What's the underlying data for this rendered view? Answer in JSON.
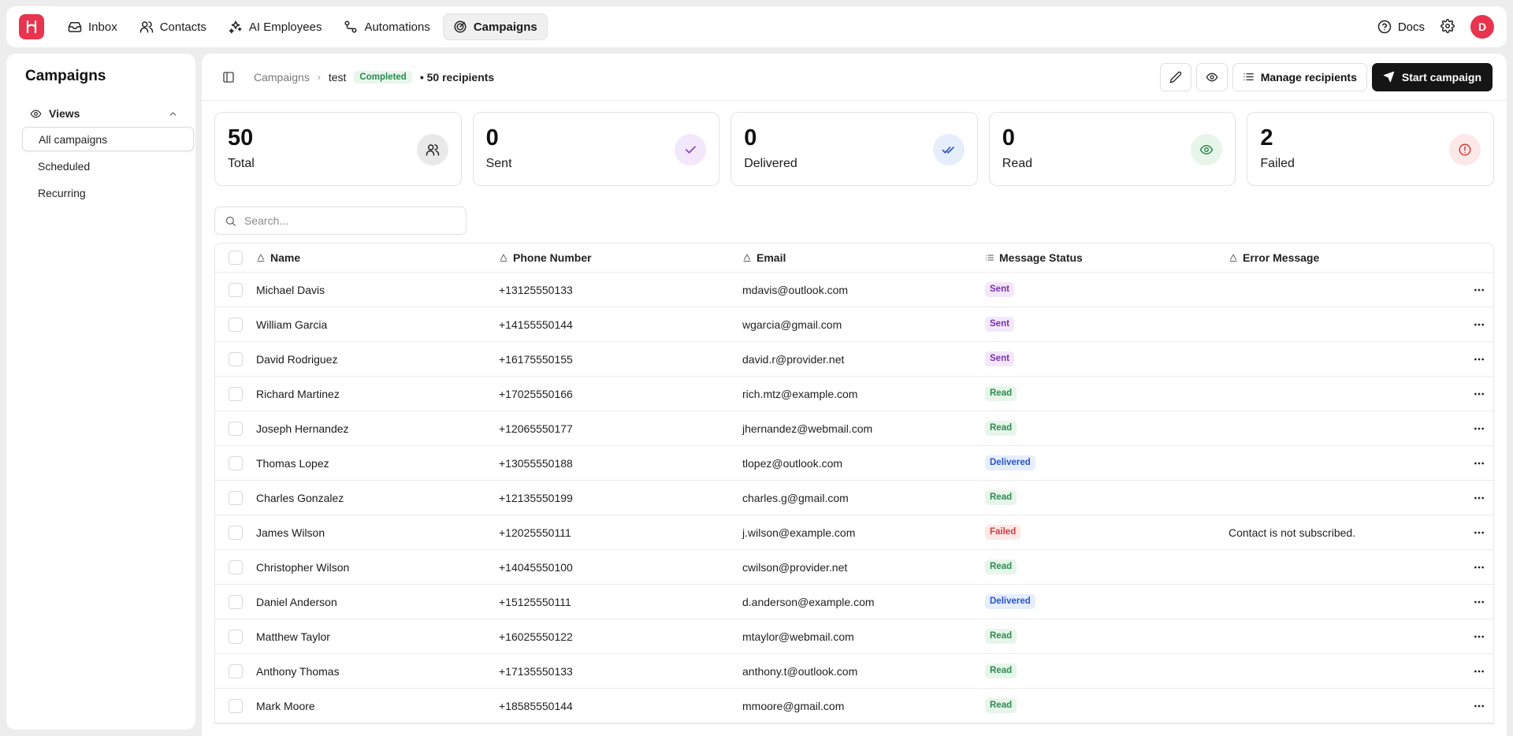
{
  "nav": {
    "items": [
      {
        "label": "Inbox",
        "icon": "inbox-icon"
      },
      {
        "label": "Contacts",
        "icon": "users-icon"
      },
      {
        "label": "AI Employees",
        "icon": "sparkles-icon"
      },
      {
        "label": "Automations",
        "icon": "workflow-icon"
      },
      {
        "label": "Campaigns",
        "icon": "target-icon"
      }
    ],
    "active": "Campaigns",
    "docs_label": "Docs",
    "avatar_initial": "D",
    "brand_color": "#e8344e"
  },
  "sidebar": {
    "title": "Campaigns",
    "views_label": "Views",
    "items": [
      {
        "label": "All campaigns"
      },
      {
        "label": "Scheduled"
      },
      {
        "label": "Recurring"
      }
    ]
  },
  "header": {
    "breadcrumb_root": "Campaigns",
    "breadcrumb_current": "test",
    "status_badge": "Completed",
    "recipients": "• 50 recipients",
    "manage_label": "Manage recipients",
    "start_label": "Start campaign"
  },
  "stats": [
    {
      "value": "50",
      "label": "Total",
      "icon": "users-icon",
      "color": "#e9e9e9"
    },
    {
      "value": "0",
      "label": "Sent",
      "icon": "check-icon",
      "color": "#f3e8fb"
    },
    {
      "value": "0",
      "label": "Delivered",
      "icon": "double-check-icon",
      "color": "#e6edfd"
    },
    {
      "value": "0",
      "label": "Read",
      "icon": "eye-icon",
      "color": "#e7f5eb"
    },
    {
      "value": "2",
      "label": "Failed",
      "icon": "alert-circle-icon",
      "color": "#fde8e8"
    }
  ],
  "search": {
    "placeholder": "Search..."
  },
  "table": {
    "columns": [
      "Name",
      "Phone Number",
      "Email",
      "Message Status",
      "Error Message"
    ],
    "rows": [
      {
        "name": "Michael Davis",
        "phone": "+13125550133",
        "email": "mdavis@outlook.com",
        "status": "Sent",
        "error": ""
      },
      {
        "name": "William Garcia",
        "phone": "+14155550144",
        "email": "wgarcia@gmail.com",
        "status": "Sent",
        "error": ""
      },
      {
        "name": "David Rodriguez",
        "phone": "+16175550155",
        "email": "david.r@provider.net",
        "status": "Sent",
        "error": ""
      },
      {
        "name": "Richard Martinez",
        "phone": "+17025550166",
        "email": "rich.mtz@example.com",
        "status": "Read",
        "error": ""
      },
      {
        "name": "Joseph Hernandez",
        "phone": "+12065550177",
        "email": "jhernandez@webmail.com",
        "status": "Read",
        "error": ""
      },
      {
        "name": "Thomas Lopez",
        "phone": "+13055550188",
        "email": "tlopez@outlook.com",
        "status": "Delivered",
        "error": ""
      },
      {
        "name": "Charles Gonzalez",
        "phone": "+12135550199",
        "email": "charles.g@gmail.com",
        "status": "Read",
        "error": ""
      },
      {
        "name": "James Wilson",
        "phone": "+12025550111",
        "email": "j.wilson@example.com",
        "status": "Failed",
        "error": "Contact is not subscribed."
      },
      {
        "name": "Christopher Wilson",
        "phone": "+14045550100",
        "email": "cwilson@provider.net",
        "status": "Read",
        "error": ""
      },
      {
        "name": "Daniel Anderson",
        "phone": "+15125550111",
        "email": "d.anderson@example.com",
        "status": "Delivered",
        "error": ""
      },
      {
        "name": "Matthew Taylor",
        "phone": "+16025550122",
        "email": "mtaylor@webmail.com",
        "status": "Read",
        "error": ""
      },
      {
        "name": "Anthony Thomas",
        "phone": "+17135550133",
        "email": "anthony.t@outlook.com",
        "status": "Read",
        "error": ""
      },
      {
        "name": "Mark Moore",
        "phone": "+18585550144",
        "email": "mmoore@gmail.com",
        "status": "Read",
        "error": ""
      }
    ]
  }
}
